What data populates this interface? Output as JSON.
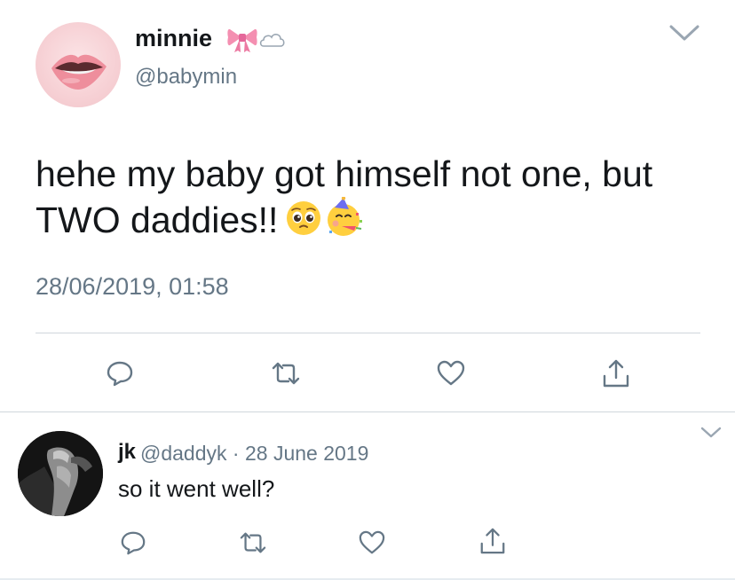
{
  "tweet": {
    "display_name": "minnie",
    "name_emojis": [
      "ribbon-emoji",
      "cloud-emoji"
    ],
    "handle": "@babymin",
    "text": "hehe my baby got himself not one, but TWO daddies!!",
    "text_emojis": [
      "pleading-face-emoji",
      "partying-face-emoji"
    ],
    "timestamp": "28/06/2019, 01:58",
    "actions": [
      "reply-icon",
      "retweet-icon",
      "like-icon",
      "share-icon"
    ]
  },
  "reply": {
    "display_name": "jk",
    "handle": "@daddyk",
    "separator": "·",
    "date": "28 June 2019",
    "text": "so it went well?",
    "actions": [
      "reply-icon",
      "retweet-icon",
      "like-icon",
      "share-icon"
    ]
  },
  "colors": {
    "text_primary": "#14171a",
    "text_secondary": "#657786",
    "icon": "#657786",
    "divider": "#d0d6db"
  }
}
